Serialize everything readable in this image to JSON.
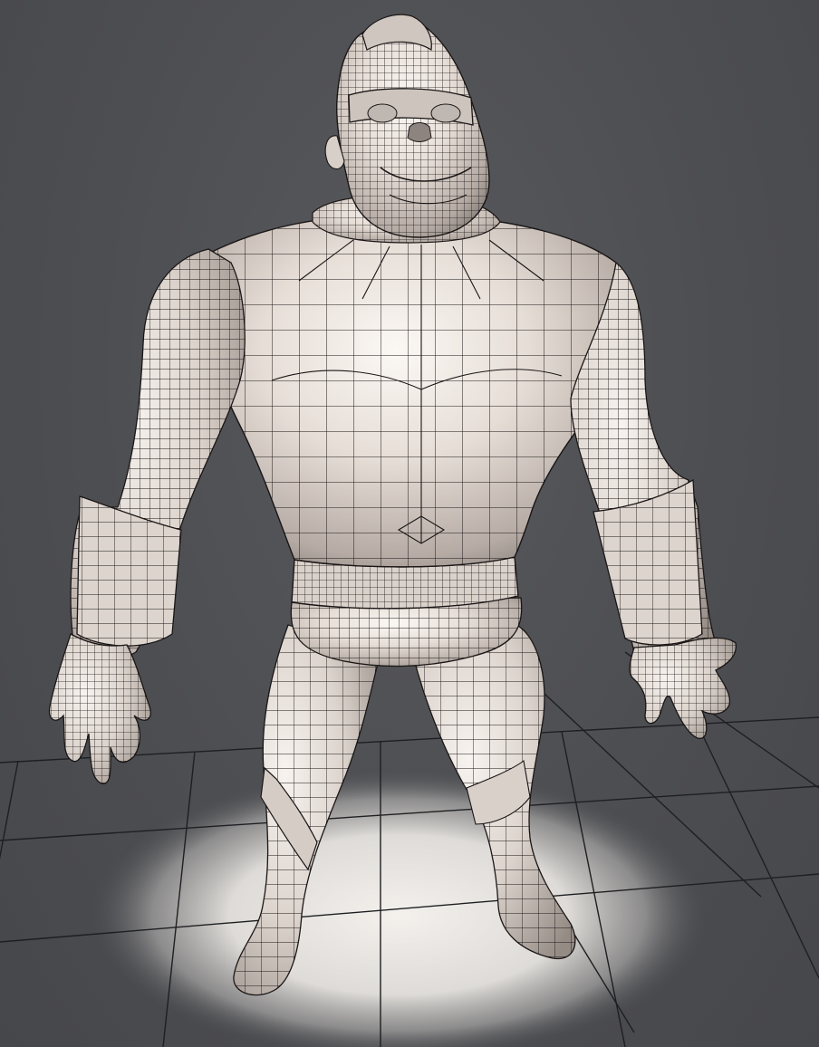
{
  "viewport": {
    "background_color": "#4a4b4f",
    "grid_line_color": "#1e1f22",
    "floor_spot_color": "#f2efeb",
    "mesh_base_color": "#e3dcd5",
    "mesh_highlight_color": "#fbf8f4",
    "mesh_shadow_color": "#9a918b",
    "wireframe_color": "#1a1616"
  },
  "model": {
    "mode": "wireframe-on-shaded"
  }
}
